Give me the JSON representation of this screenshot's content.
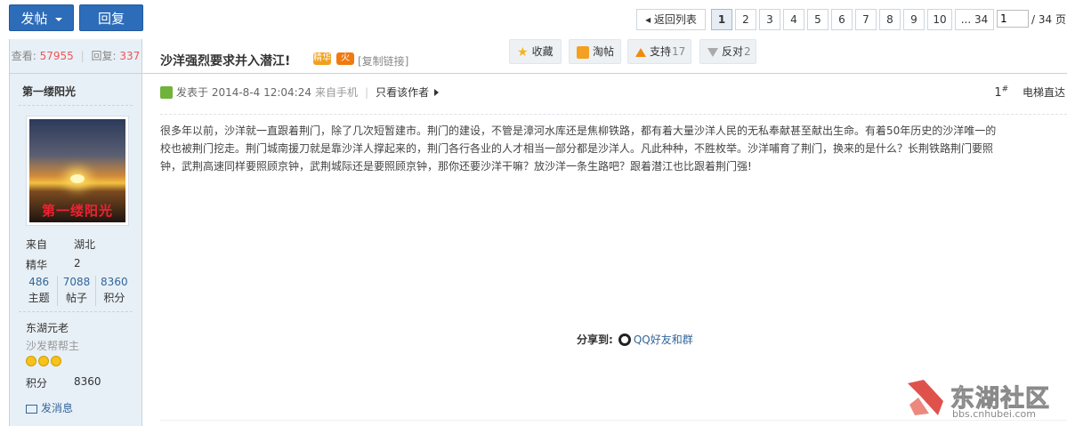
{
  "toolbar": {
    "post_label": "发帖",
    "reply_label": "回复"
  },
  "pager": {
    "back_label": "◂ 返回列表",
    "pages": [
      "1",
      "2",
      "3",
      "4",
      "5",
      "6",
      "7",
      "8",
      "9",
      "10"
    ],
    "current": "1",
    "last_label": "... 34",
    "input_value": "1",
    "total_label": "/ 34 页"
  },
  "sidebar": {
    "views_label": "查看:",
    "views": "57955",
    "replies_label": "回复:",
    "replies": "337",
    "username": "第一缕阳光",
    "avatar_signature": "第一缕阳光",
    "from_label": "来自",
    "from_value": "湖北",
    "digest_label": "精华",
    "digest_value": "2",
    "counts": [
      {
        "num": "486",
        "label": "主题"
      },
      {
        "num": "7088",
        "label": "帖子"
      },
      {
        "num": "8360",
        "label": "积分"
      }
    ],
    "rank": "东湖元老",
    "group": "沙发帮帮主",
    "points_label": "积分",
    "points_value": "8360",
    "pm_label": "发消息"
  },
  "post": {
    "title": "沙洋强烈要求并入潜江!",
    "badge_1": "精华",
    "badge_2": "火",
    "copy_link": "[复制链接]",
    "posted_label": "发表于 2014-8-4 12:04:24",
    "device": "来自手机",
    "only_author": "只看该作者",
    "floor": "1",
    "floor_sup": "#",
    "elevator": "电梯直达",
    "content_lines": [
      "很多年以前，沙洋就一直跟着荆门，除了几次短暂建市。荆门的建设，不管是漳河水库还是焦柳铁路，都有着大量沙洋人民的无私奉献甚至献出生命。有着50年历史的沙洋唯一的",
      "校也被荆门挖走。荆门城南援刀就是靠沙洋人撑起来的，荆门各行各业的人才相当一部分都是沙洋人。凡此种种，不胜枚举。沙洋哺育了荆门，换来的是什么？长荆铁路荆门要照",
      "钟，武荆高速同样要照顾京钟，武荆城际还是要照顾京钟，那你还要沙洋干嘛？放沙洋一条生路吧？跟着潜江也比跟着荆门强!"
    ]
  },
  "share": {
    "label": "分享到:",
    "qq_label": "QQ好友和群"
  },
  "actions": {
    "fav": "收藏",
    "shop": "淘帖",
    "up": "支持",
    "up_count": "17",
    "down": "反对",
    "down_count": "2"
  },
  "watermark": {
    "name": "东湖社区",
    "url": "bbs.cnhubei.com"
  },
  "colors": {
    "primary_button": "#2d6cb8",
    "sidebar_bg": "#e8f0f7",
    "link": "#336699",
    "stat_red": "#e55555",
    "watermark_red": "#d9342b"
  }
}
